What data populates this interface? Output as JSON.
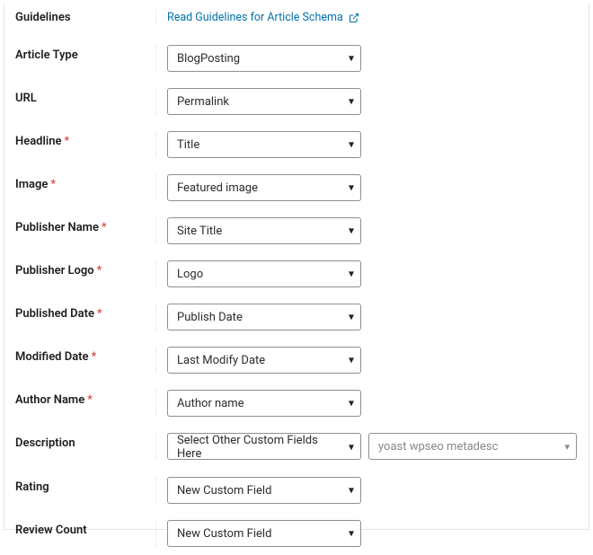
{
  "rows": {
    "guidelines": {
      "label": "Guidelines",
      "required": false
    },
    "articleType": {
      "label": "Article Type",
      "required": false
    },
    "url": {
      "label": "URL",
      "required": false
    },
    "headline": {
      "label": "Headline",
      "required": true
    },
    "image": {
      "label": "Image",
      "required": true
    },
    "publisherName": {
      "label": "Publisher Name",
      "required": true
    },
    "publisherLogo": {
      "label": "Publisher Logo",
      "required": true
    },
    "publishedDate": {
      "label": "Published Date",
      "required": true
    },
    "modifiedDate": {
      "label": "Modified Date",
      "required": true
    },
    "authorName": {
      "label": "Author Name",
      "required": true
    },
    "description": {
      "label": "Description",
      "required": false
    },
    "rating": {
      "label": "Rating",
      "required": false
    },
    "reviewCount": {
      "label": "Review Count",
      "required": false
    }
  },
  "fields": {
    "guidelinesLink": "Read Guidelines for Article Schema",
    "articleType": "BlogPosting",
    "url": "Permalink",
    "headline": "Title",
    "image": "Featured image",
    "publisherName": "Site Title",
    "publisherLogo": "Logo",
    "publishedDate": "Publish Date",
    "modifiedDate": "Last Modify Date",
    "authorName": "Author name",
    "description": "Select Other Custom Fields Here",
    "descriptionValue": "yoast wpseo metadesc",
    "rating": "New Custom Field",
    "reviewCount": "New Custom Field"
  },
  "requiredMark": "*"
}
